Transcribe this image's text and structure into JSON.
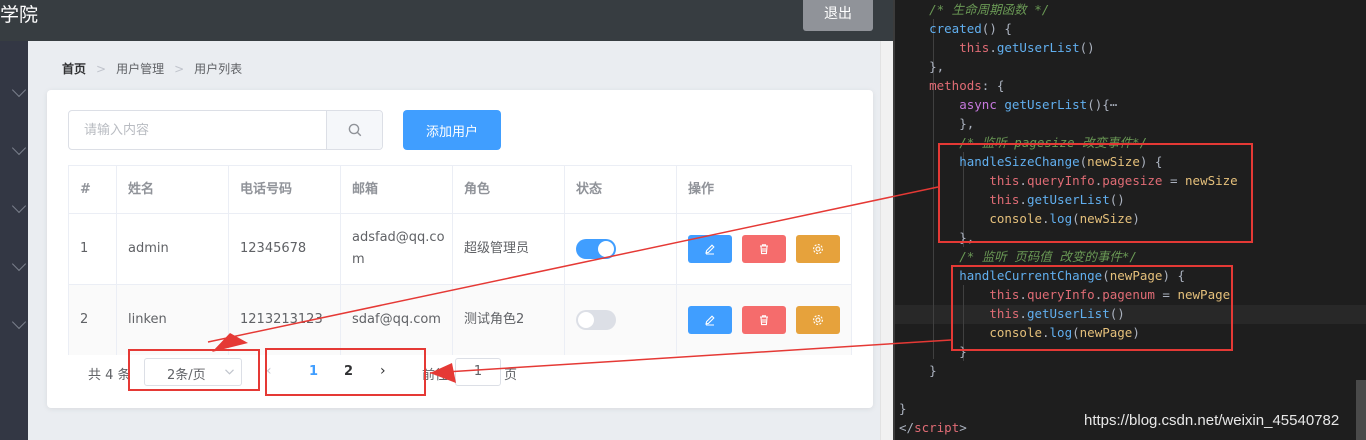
{
  "app": {
    "title": "学院",
    "logout_label": "退出",
    "breadcrumb": [
      "首页",
      "用户管理",
      "用户列表"
    ],
    "search": {
      "placeholder": "请输入内容",
      "value": ""
    },
    "add_user_label": "添加用户",
    "table": {
      "columns": [
        "#",
        "姓名",
        "电话号码",
        "邮箱",
        "角色",
        "状态",
        "操作"
      ],
      "rows": [
        {
          "index": "1",
          "name": "admin",
          "phone": "12345678",
          "email": "adsfad@qq.com",
          "role": "超级管理员",
          "status": true
        },
        {
          "index": "2",
          "name": "linken",
          "phone": "1213213123",
          "email": "sdaf@qq.com",
          "role": "测试角色2",
          "status": false
        }
      ]
    },
    "pagination": {
      "total_text": "共 4 条",
      "page_size_text": "2条/页",
      "pages": [
        "1",
        "2"
      ],
      "current_page": "1",
      "goto_prefix": "前往",
      "goto_value": "1",
      "goto_suffix": "页"
    }
  },
  "editor": {
    "lines": [
      [
        [
          "cm",
          "    /* 生命周期函数 */"
        ]
      ],
      [
        [
          "fn",
          "    created"
        ],
        [
          "pl",
          "() {"
        ]
      ],
      [
        [
          "pl",
          "        "
        ],
        [
          "th",
          "this"
        ],
        [
          "pl",
          "."
        ],
        [
          "fn",
          "getUserList"
        ],
        [
          "pl",
          "()"
        ]
      ],
      [
        [
          "pl",
          "    },"
        ]
      ],
      [
        [
          "pr",
          "    methods"
        ],
        [
          "pl",
          ": {"
        ]
      ],
      [
        [
          "pl",
          "        "
        ],
        [
          "kw",
          "async"
        ],
        [
          "pl",
          " "
        ],
        [
          "fn",
          "getUserList"
        ],
        [
          "pl",
          "(){⋯"
        ]
      ],
      [
        [
          "pl",
          "        },"
        ]
      ],
      [
        [
          "cm",
          "        /* 监听 pagesize 改变事件*/"
        ]
      ],
      [
        [
          "pl",
          "        "
        ],
        [
          "fn",
          "handleSizeChange"
        ],
        [
          "pl",
          "("
        ],
        [
          "pm",
          "newSize"
        ],
        [
          "pl",
          ") {"
        ]
      ],
      [
        [
          "pl",
          "            "
        ],
        [
          "th",
          "this"
        ],
        [
          "pl",
          "."
        ],
        [
          "pr",
          "queryInfo"
        ],
        [
          "pl",
          "."
        ],
        [
          "pr",
          "pagesize"
        ],
        [
          "pl",
          " = "
        ],
        [
          "pm",
          "newSize"
        ]
      ],
      [
        [
          "pl",
          "            "
        ],
        [
          "th",
          "this"
        ],
        [
          "pl",
          "."
        ],
        [
          "fn",
          "getUserList"
        ],
        [
          "pl",
          "()"
        ]
      ],
      [
        [
          "pl",
          "            "
        ],
        [
          "pm",
          "console"
        ],
        [
          "pl",
          "."
        ],
        [
          "fn",
          "log"
        ],
        [
          "pl",
          "("
        ],
        [
          "pm",
          "newSize"
        ],
        [
          "pl",
          ")"
        ]
      ],
      [
        [
          "pl",
          "        },"
        ]
      ],
      [
        [
          "cm",
          "        /* 监听 页码值 改变的事件*/"
        ]
      ],
      [
        [
          "pl",
          "        "
        ],
        [
          "fn",
          "handleCurrentChange"
        ],
        [
          "pl",
          "("
        ],
        [
          "pm",
          "newPage"
        ],
        [
          "pl",
          ") {"
        ]
      ],
      [
        [
          "pl",
          "            "
        ],
        [
          "th",
          "this"
        ],
        [
          "pl",
          "."
        ],
        [
          "pr",
          "queryInfo"
        ],
        [
          "pl",
          "."
        ],
        [
          "pr",
          "pagenum"
        ],
        [
          "pl",
          " = "
        ],
        [
          "pm",
          "newPage"
        ]
      ],
      [
        [
          "pl",
          "            "
        ],
        [
          "th",
          "this"
        ],
        [
          "pl",
          "."
        ],
        [
          "fn",
          "getUserList"
        ],
        [
          "pl",
          "()"
        ]
      ],
      [
        [
          "pl",
          "            "
        ],
        [
          "pm",
          "console"
        ],
        [
          "pl",
          "."
        ],
        [
          "fn",
          "log"
        ],
        [
          "pl",
          "("
        ],
        [
          "pm",
          "newPage"
        ],
        [
          "pl",
          ")"
        ]
      ],
      [
        [
          "pl",
          "        }"
        ]
      ],
      [
        [
          "pl",
          "    }"
        ]
      ],
      [
        [
          "pl",
          ""
        ]
      ],
      [
        [
          "pl",
          "}"
        ]
      ],
      [
        [
          "pl",
          "</"
        ],
        [
          "tg",
          "script"
        ],
        [
          "pl",
          ">"
        ]
      ]
    ]
  },
  "watermark": "https://blog.csdn.net/weixin_45540782",
  "colors": {
    "primary": "#409eff",
    "danger": "#f56c6c",
    "warning": "#e6a23c",
    "annotation": "#e53935",
    "switch_off": "#dcdfe6"
  },
  "icons": {
    "search": "search-icon",
    "edit": "edit-icon",
    "delete": "delete-icon",
    "setting": "setting-icon",
    "chevron_left": "chevron-left-icon",
    "chevron_right": "chevron-right-icon",
    "dropdown": "chevron-down-icon"
  }
}
